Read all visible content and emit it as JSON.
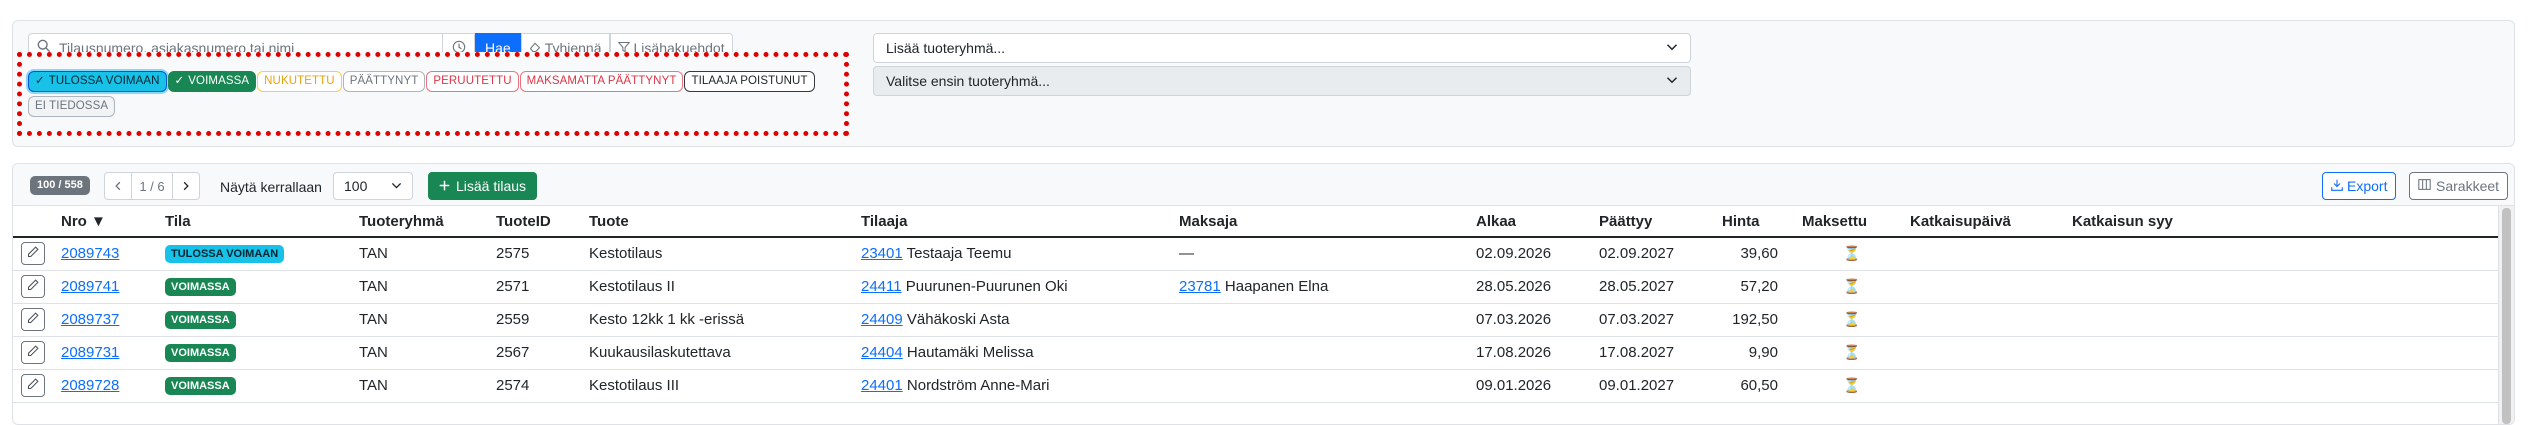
{
  "search": {
    "placeholder": "Tilausnumero, asiakasnumero tai nimi",
    "search_label": "Hae",
    "clear_label": "Tyhjennä",
    "advanced_label": "Lisähakuehdot"
  },
  "status_filters": [
    {
      "label": "TULOSSA VOIMAAN",
      "kind": "upcoming",
      "selected": true,
      "check": "✓"
    },
    {
      "label": "VOIMASSA",
      "kind": "active",
      "selected": true,
      "check": "✓"
    },
    {
      "label": "NUKUTETTU",
      "kind": "paused",
      "selected": false,
      "check": ""
    },
    {
      "label": "PÄÄTTYNYT",
      "kind": "ended",
      "selected": false,
      "check": ""
    },
    {
      "label": "PERUUTETTU",
      "kind": "cancelled",
      "selected": false,
      "check": ""
    },
    {
      "label": "MAKSAMATTA PÄÄTTYNYT",
      "kind": "unpaid",
      "selected": false,
      "check": ""
    },
    {
      "label": "TILAAJA POISTUNUT",
      "kind": "removed",
      "selected": false,
      "check": ""
    },
    {
      "label": "EI TIEDOSSA",
      "kind": "unknown",
      "selected": false,
      "check": ""
    }
  ],
  "product_group_select": {
    "value": "Lisää tuoteryhmä..."
  },
  "product_select": {
    "value": "Valitse ensin tuoteryhmä..."
  },
  "toolbar": {
    "count": "100 / 558",
    "page_info": "1 / 6",
    "per_page_label": "Näytä kerrallaan",
    "per_page_value": "100",
    "add_label": "Lisää tilaus",
    "export_label": "Export",
    "columns_label": "Sarakkeet"
  },
  "columns": [
    "Nro ▼",
    "Tila",
    "Tuoteryhmä",
    "TuoteID",
    "Tuote",
    "Tilaaja",
    "Maksaja",
    "Alkaa",
    "Päättyy",
    "Hinta",
    "Maksettu",
    "Katkaisupäivä",
    "Katkaisun syy"
  ],
  "rows": [
    {
      "nro": "2089743",
      "tila": "TULOSSA VOIMAAN",
      "tila_kind": "upcoming",
      "ryhma": "TAN",
      "tuoteid": "2575",
      "tuote": "Kestotilaus",
      "tilaaja_id": "23401",
      "tilaaja_nimi": "Testaaja Teemu",
      "maksaja_id": "",
      "maksaja_nimi": "—",
      "alkaa": "02.09.2026",
      "paattyy": "02.09.2027",
      "hinta": "39,60",
      "maksettu": "⏳",
      "katkaisupaiva": "",
      "katkaisun_syy": ""
    },
    {
      "nro": "2089741",
      "tila": "VOIMASSA",
      "tila_kind": "active",
      "ryhma": "TAN",
      "tuoteid": "2571",
      "tuote": "Kestotilaus II",
      "tilaaja_id": "24411",
      "tilaaja_nimi": "Puurunen-Puurunen Oki",
      "maksaja_id": "23781",
      "maksaja_nimi": "Haapanen Elna",
      "alkaa": "28.05.2026",
      "paattyy": "28.05.2027",
      "hinta": "57,20",
      "maksettu": "⏳",
      "katkaisupaiva": "",
      "katkaisun_syy": ""
    },
    {
      "nro": "2089737",
      "tila": "VOIMASSA",
      "tila_kind": "active",
      "ryhma": "TAN",
      "tuoteid": "2559",
      "tuote": "Kesto 12kk 1 kk -erissä",
      "tilaaja_id": "24409",
      "tilaaja_nimi": "Vähäkoski Asta",
      "maksaja_id": "",
      "maksaja_nimi": "",
      "alkaa": "07.03.2026",
      "paattyy": "07.03.2027",
      "hinta": "192,50",
      "maksettu": "⏳",
      "katkaisupaiva": "",
      "katkaisun_syy": ""
    },
    {
      "nro": "2089731",
      "tila": "VOIMASSA",
      "tila_kind": "active",
      "ryhma": "TAN",
      "tuoteid": "2567",
      "tuote": "Kuukausilaskutettava",
      "tilaaja_id": "24404",
      "tilaaja_nimi": "Hautamäki Melissa",
      "maksaja_id": "",
      "maksaja_nimi": "",
      "alkaa": "17.08.2026",
      "paattyy": "17.08.2027",
      "hinta": "9,90",
      "maksettu": "⏳",
      "katkaisupaiva": "",
      "katkaisun_syy": ""
    },
    {
      "nro": "2089728",
      "tila": "VOIMASSA",
      "tila_kind": "active",
      "ryhma": "TAN",
      "tuoteid": "2574",
      "tuote": "Kestotilaus III",
      "tilaaja_id": "24401",
      "tilaaja_nimi": "Nordström Anne-Mari",
      "maksaja_id": "",
      "maksaja_nimi": "",
      "alkaa": "09.01.2026",
      "paattyy": "09.01.2027",
      "hinta": "60,50",
      "maksettu": "⏳",
      "katkaisupaiva": "",
      "katkaisun_syy": ""
    }
  ]
}
